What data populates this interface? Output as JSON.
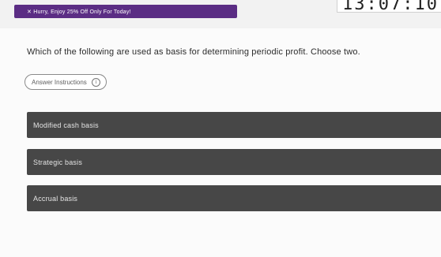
{
  "banner": {
    "promo_text": "✕  Hurry, Enjoy 25% Off Only For Today!"
  },
  "timer": {
    "value": "13:07:10"
  },
  "question": {
    "text": "Which of the following are used as basis for determining periodic profit. Choose two."
  },
  "answer_instructions": {
    "label": "Answer Instructions",
    "icon": "info-icon"
  },
  "options": [
    {
      "label": "Modified cash basis"
    },
    {
      "label": "Strategic basis"
    },
    {
      "label": "Accrual basis"
    }
  ],
  "colors": {
    "promo_bg": "#5b2d84",
    "option_bg": "#474747",
    "page_bg": "#f2f2f2"
  }
}
